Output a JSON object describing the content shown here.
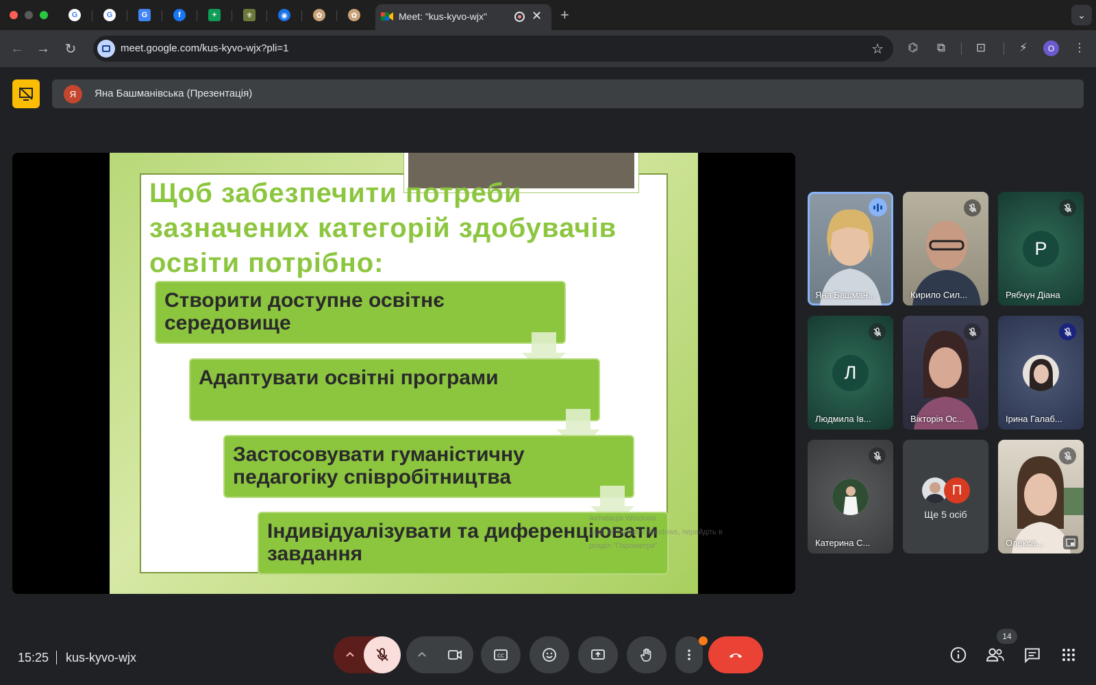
{
  "browser": {
    "active_tab_title": "Meet: \"kus-kyvo-wjx\"",
    "url": "meet.google.com/kus-kyvo-wjx?pli=1",
    "profile_initial": "O"
  },
  "meet": {
    "presenter_initial": "Я",
    "presenter_label": "Яна Башманівська (Презентація)",
    "slide": {
      "title": "Щоб забезпечити потреби зазначених категорій здобувачів освіти потрібно:",
      "steps": [
        "Створити доступне освітнє середовище",
        "Адаптувати освітні програми",
        "Застосовувати гуманістичну педагогіку співробітництва",
        "Індивідуалізувати та диференціювати завдання"
      ],
      "watermark_line1": "Активація Windows",
      "watermark_line2": "Щоб активувати Windows, перейдіть в",
      "watermark_line3": "розділ \"Параметри\"."
    },
    "participants": [
      {
        "name": "Яна Башман...",
        "state": "speaking"
      },
      {
        "name": "Кирило Сил...",
        "state": "muted"
      },
      {
        "name": "Рябчун Діана",
        "state": "muted",
        "initial": "Р"
      },
      {
        "name": "Людмила Ів...",
        "state": "muted",
        "initial": "Л"
      },
      {
        "name": "Вікторія Ос...",
        "state": "muted"
      },
      {
        "name": "Ірина Галаб...",
        "state": "muted"
      },
      {
        "name": "Катерина С...",
        "state": "muted"
      },
      {
        "name": "Ще 5 осіб",
        "state": "more",
        "initial": "П"
      },
      {
        "name": "Олекса...",
        "state": "muted"
      }
    ],
    "footer": {
      "time": "15:25",
      "meeting_code": "kus-kyvo-wjx",
      "people_count": "14"
    },
    "colors": {
      "accent_blue": "#8ab4f8",
      "present_yellow": "#fbbc04",
      "end_call_red": "#ea4335",
      "slide_green": "#8cc63f"
    }
  }
}
